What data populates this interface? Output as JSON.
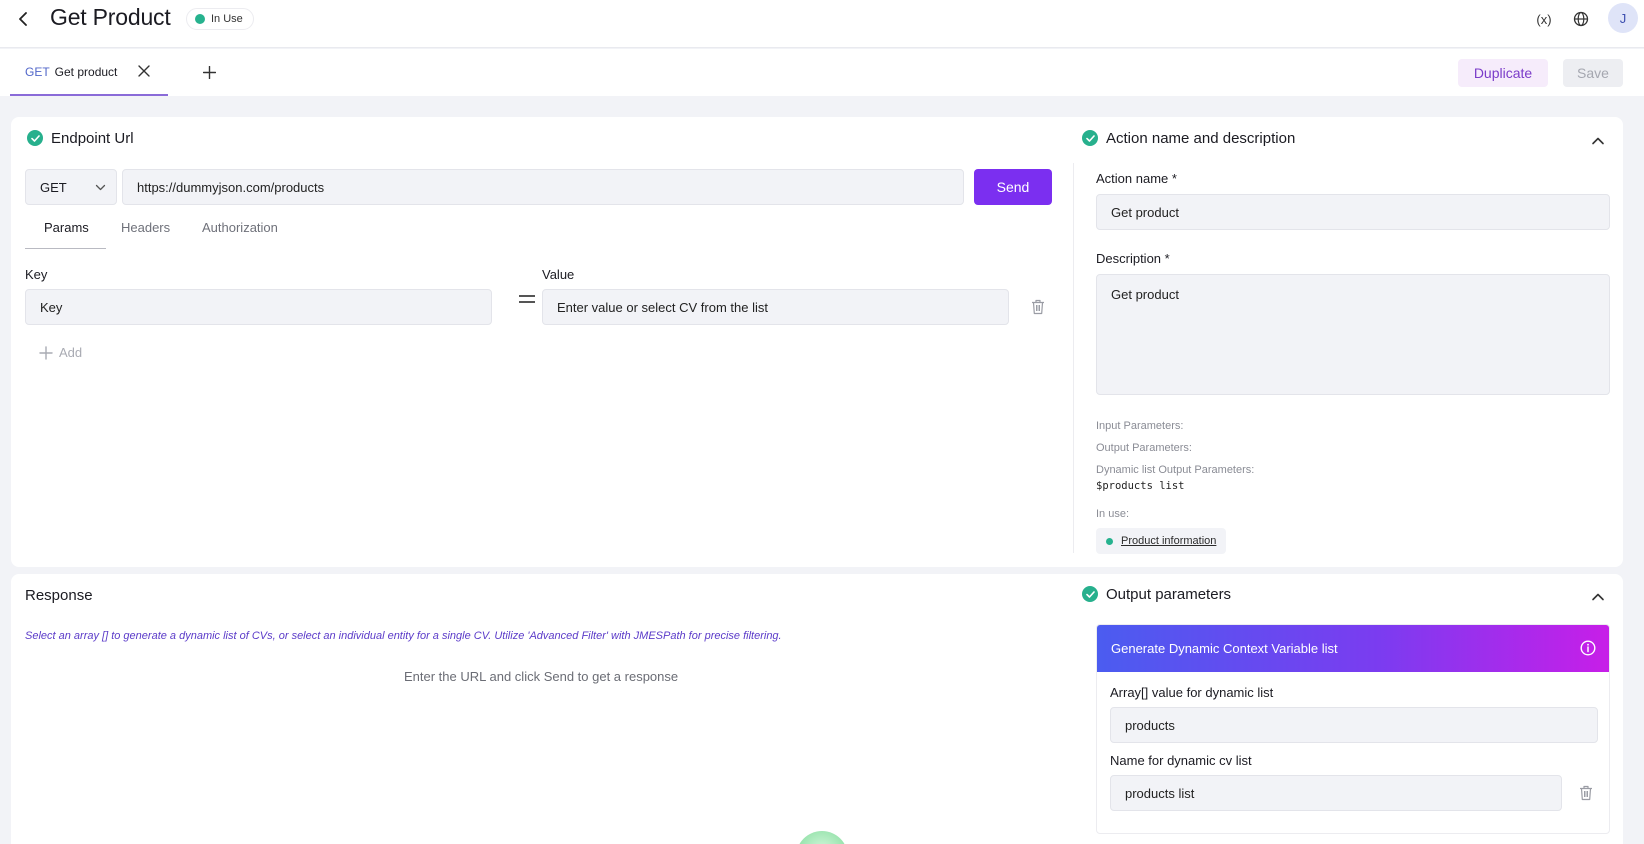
{
  "header": {
    "title": "Get Product",
    "status": "In Use",
    "variables_icon": "variable-icon",
    "variables_label": "(x)",
    "globe_icon": "globe-icon",
    "avatar_initial": "J"
  },
  "tabs": {
    "active": {
      "method": "GET",
      "label": "Get product"
    },
    "duplicate_label": "Duplicate",
    "save_label": "Save"
  },
  "endpoint": {
    "title": "Endpoint Url",
    "method": "GET",
    "url": "https://dummyjson.com/products",
    "send_label": "Send",
    "subtabs": [
      "Params",
      "Headers",
      "Authorization"
    ],
    "key_label": "Key",
    "value_label": "Value",
    "key_placeholder": "Key",
    "value_placeholder": "Enter value or select CV from the list",
    "add_label": "Add"
  },
  "action": {
    "title": "Action name and description",
    "name_label": "Action name *",
    "name_value": "Get product",
    "description_label": "Description *",
    "description_value": "Get product",
    "input_params_label": "Input Parameters:",
    "output_params_label": "Output Parameters:",
    "dynamic_list_label": "Dynamic list Output Parameters:",
    "dynamic_list_value": "$products list",
    "in_use_label": "In use:",
    "in_use_item": "Product information"
  },
  "response": {
    "title": "Response",
    "hint": "Select an array [] to generate a dynamic list of CVs, or select an individual entity for a single CV. Utilize 'Advanced Filter' with JMESPath for precise filtering.",
    "empty_message": "Enter the URL and click Send to get a response"
  },
  "output": {
    "title": "Output parameters",
    "panel_title": "Generate Dynamic Context Variable list",
    "array_label": "Array[] value for dynamic list",
    "array_value": "products",
    "name_label": "Name for dynamic cv list",
    "name_value": "products list"
  },
  "colors": {
    "accent": "#7b2ff0",
    "success": "#27b08d",
    "gradient_start": "#4b5cf0",
    "gradient_end": "#c81ee8"
  }
}
